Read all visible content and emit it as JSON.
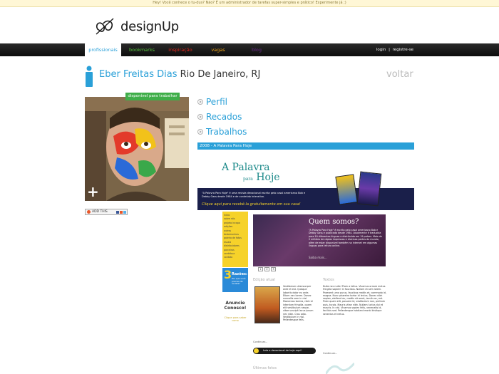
{
  "notice": {
    "text": "Hey! Você conhece o tu-dus? Não? É um administrador de tarefas super-simples e prático! Experimente já ;)"
  },
  "brand": {
    "name": "designUp"
  },
  "nav": {
    "tabs": [
      {
        "label": "profissionais",
        "color": "#2aa0d8",
        "active": true
      },
      {
        "label": "bookmarks",
        "color": "#56c23c",
        "active": false
      },
      {
        "label": "inspiração",
        "color": "#e0241b",
        "active": false
      },
      {
        "label": "vagas",
        "color": "#f2a516",
        "active": false
      },
      {
        "label": "blog",
        "color": "#6a2a8a",
        "active": false
      }
    ],
    "login": "login",
    "separator": "|",
    "register": "registre-se"
  },
  "profile": {
    "name": "Eber Freitas Dias",
    "city": "Rio De Janeiro, RJ",
    "back": "voltar",
    "availability": "disponível para trabalhar",
    "plus": "+"
  },
  "addthis": {
    "label": "ADD THIS"
  },
  "sections": [
    {
      "label": "Perfil"
    },
    {
      "label": "Recados"
    },
    {
      "label": "Trabalhos"
    }
  ],
  "work": {
    "title": "2008 - A Palavra Para Hoje",
    "screenshot": {
      "title_line1": "A Palavra",
      "title_para": "para",
      "title_line2": "Hoje",
      "intro": "\"A Palavra Para Hoje\" é uma revista devocional escrita pelo casal americano Bob e Debby Gass desde 1984 e de conteúdo interativo.",
      "cta": "Clique aqui para recebê-la gratuitamente em sua casa!",
      "left_nav": [
        "início",
        "sobre nós",
        "projeto incapa",
        "edições",
        "outros",
        "testemunhos",
        "galeria de fotos",
        "escala",
        "distribuidores",
        "parceiros",
        "contribua",
        "contato"
      ],
      "hero_title": "Quem somos?",
      "hero_text": "\"A Palavra Para Hoje\" é escrita pelo casal americano Bob e Debby Gass e publicada desde 1984. Atualmente é traduzida para 10 diferentes línguas e distribuída em 19 países. Mais de 2 milhões de cópias impressas e diversas partes do mundo, além de estar disponível também na internet em algumas línguas para leitura online.",
      "hero_more": "Saiba mais...",
      "pages": [
        "1",
        "2",
        "3"
      ],
      "reasons_num": "3",
      "reasons_word": "Razões:",
      "reasons_q": "Por que você precisa da revista?",
      "anuncie": "Anuncie Conosco!",
      "anuncie_sub": "Clique para saber como",
      "col1_head": "Edição atual",
      "col1_text": "Vestibulum ullamcorper ante et est. Quisque lobortis dolor eu ante. Etiam nec lorem. Donec convallis sem in nisl. Maecenas lacinia, nibh id interdum fringilla, quam elit vestibulum neque, vitae suscipit lacus ipsum nec nibh. Cras odio. Vestibulum in nisl. Pellentesque felis.",
      "col1_more": "Continuar...",
      "col2_head": "Textos",
      "col2_text": "Nulla nec nulla! Proin a tellus. Vivamus ornare metus fringilla sapien! In faucibus. Nullam et sem lorem. Praesent urna purus, faucibus mattis et, commodo id, magna. Nunc pharetra tortor id lectus. Donec nibh sapien, eleifend eu, mattis sit amet, iaculis ac, est. Proin quam elit, posuere id, vestibulum non, pretium quis, turpis. Mauris vitae nibh. Nullam luctus dui et mauris. In nisl. Vivamus sapien felis, venenatis id, facilisis sed. Pellentesque habitant morbi tristique senectus et netus.",
      "col2_more": "Continuar...",
      "cta_bar": "Leia o devocional de hoje aqui!",
      "ultimas": "Últimas fotos"
    }
  },
  "colors": {
    "accent": "#2aa0d8",
    "badge": "#3fae49",
    "navbar": "#111111"
  }
}
